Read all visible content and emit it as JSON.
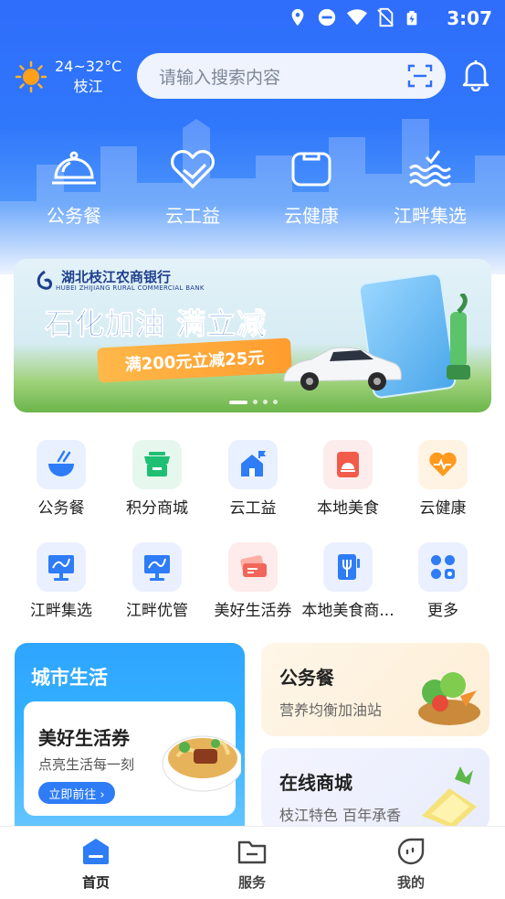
{
  "status_bar": {
    "time": "3:07"
  },
  "weather": {
    "temperature": "24~32°C",
    "city": "枝江"
  },
  "search": {
    "placeholder": "请输入搜索内容"
  },
  "top_nav": [
    {
      "label": "公务餐",
      "icon": "dining-cloche-icon"
    },
    {
      "label": "云工益",
      "icon": "heart-hands-icon"
    },
    {
      "label": "云健康",
      "icon": "health-box-icon"
    },
    {
      "label": "江畔集选",
      "icon": "river-waves-icon"
    }
  ],
  "banner": {
    "bank_name": "湖北枝江农商银行",
    "bank_name_en": "HUBEI ZHIJIANG RURAL COMMERCIAL BANK",
    "title": "石化加油 满立减",
    "subtitle": "满200元立减25元"
  },
  "grid": [
    {
      "label": "公务餐",
      "icon": "bowl-icon",
      "bg": "#e9f0ff"
    },
    {
      "label": "积分商城",
      "icon": "store-icon",
      "bg": "#e6f7ee"
    },
    {
      "label": "云工益",
      "icon": "house-flag-icon",
      "bg": "#e9f0ff"
    },
    {
      "label": "本地美食",
      "icon": "food-bell-icon",
      "bg": "#fdecec"
    },
    {
      "label": "云健康",
      "icon": "health-heart-icon",
      "bg": "#fff3e3"
    },
    {
      "label": "江畔集选",
      "icon": "monitor-icon",
      "bg": "#eaf0ff"
    },
    {
      "label": "江畔优管",
      "icon": "monitor-chart-icon",
      "bg": "#eaf0ff"
    },
    {
      "label": "美好生活券",
      "icon": "ticket-icon",
      "bg": "#fdeceb"
    },
    {
      "label": "本地美食商...",
      "icon": "fork-card-icon",
      "bg": "#eaf0ff"
    },
    {
      "label": "更多",
      "icon": "more-grid-icon",
      "bg": "#eaf0ff"
    }
  ],
  "city_card": {
    "title": "城市生活",
    "inner_title": "美好生活券",
    "inner_sub": "点亮生活每一刻",
    "button": "立即前往 ›"
  },
  "side_cards": [
    {
      "title": "公务餐",
      "subtitle": "营养均衡加油站"
    },
    {
      "title": "在线商城",
      "subtitle": "枝江特色 百年承香"
    }
  ],
  "tabbar": [
    {
      "label": "首页",
      "icon": "home-icon",
      "active": true
    },
    {
      "label": "服务",
      "icon": "folder-icon",
      "active": false
    },
    {
      "label": "我的",
      "icon": "profile-face-icon",
      "active": false
    }
  ],
  "colors": {
    "brand_blue": "#2f6dfb",
    "accent_orange": "#ff9d2e",
    "tab_active": "#2e7cf6"
  }
}
